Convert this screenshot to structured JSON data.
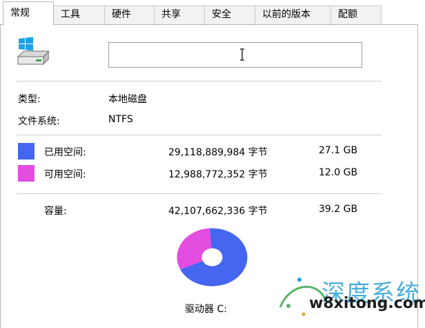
{
  "tabs": [
    "常规",
    "工具",
    "硬件",
    "共享",
    "安全",
    "以前的版本",
    "配额"
  ],
  "name_field": {
    "value": ""
  },
  "properties": {
    "type_label": "类型:",
    "type_value": "本地磁盘",
    "fs_label": "文件系统:",
    "fs_value": "NTFS"
  },
  "usage": {
    "used": {
      "label": "已用空间:",
      "bytes": "29,118,889,984 字节",
      "size": "27.1 GB",
      "color": "#4466f0",
      "fraction": 0.692
    },
    "free": {
      "label": "可用空间:",
      "bytes": "12,988,772,352 字节",
      "size": "12.0 GB",
      "color": "#e24de0",
      "fraction": 0.308
    },
    "capacity": {
      "label": "容量:",
      "bytes": "42,107,662,336 字节",
      "size": "39.2 GB"
    }
  },
  "drive_label": "驱动器 C:",
  "watermark": {
    "top": "深度系统",
    "bottom": "w8xitong.com"
  }
}
